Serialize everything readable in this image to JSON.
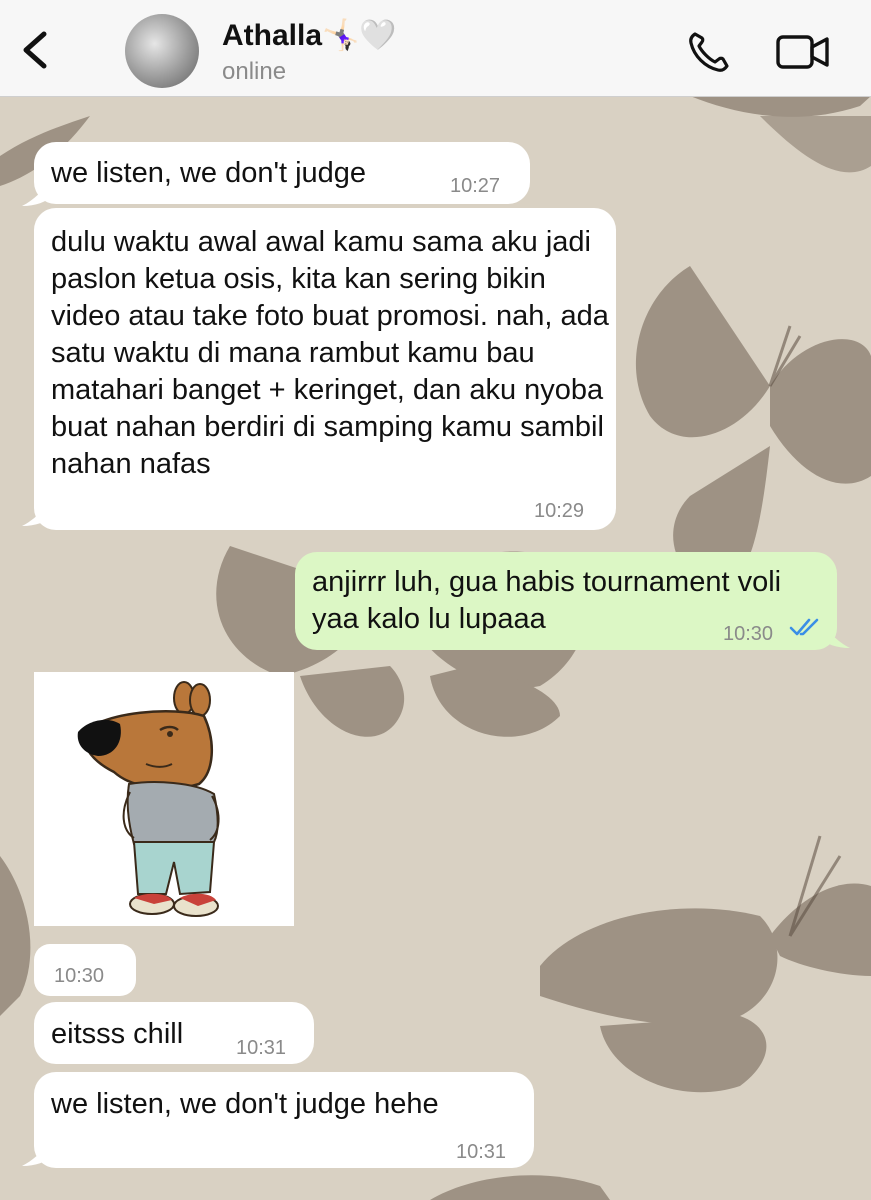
{
  "header": {
    "contact_name": "Athalla🤸🏻‍♀️🤍",
    "status": "online",
    "icons": [
      "back-chevron-icon",
      "phone-icon",
      "video-camera-icon"
    ]
  },
  "messages": [
    {
      "dir": "in",
      "text": "we listen, we don't judge",
      "time": "10:27"
    },
    {
      "dir": "in",
      "text": "dulu waktu awal awal kamu sama aku jadi paslon ketua osis, kita kan sering bikin video atau take foto buat promosi. nah, ada satu waktu di mana rambut kamu bau matahari banget + keringet, dan aku nyoba buat nahan berdiri di samping kamu sambil nahan nafas",
      "time": "10:29"
    },
    {
      "dir": "out",
      "text": "anjirrr luh, gua habis tournament voli yaa kalo lu lupaaa",
      "time": "10:30",
      "status_icon": "double-check-read-icon"
    },
    {
      "dir": "in",
      "type": "sticker",
      "sticker": "bear-in-sweater-sticker",
      "time": "10:30"
    },
    {
      "dir": "in",
      "text": "eitsss chill",
      "time": "10:31"
    },
    {
      "dir": "in",
      "text": "we listen, we don't judge hehe",
      "time": "10:31"
    }
  ],
  "colors": {
    "incoming_bubble": "#ffffff",
    "outgoing_bubble": "#dcf7c5",
    "wallpaper": "#d9d1c3",
    "read_ticks": "#3a8ee6",
    "header_bg": "#f7f7f7"
  }
}
